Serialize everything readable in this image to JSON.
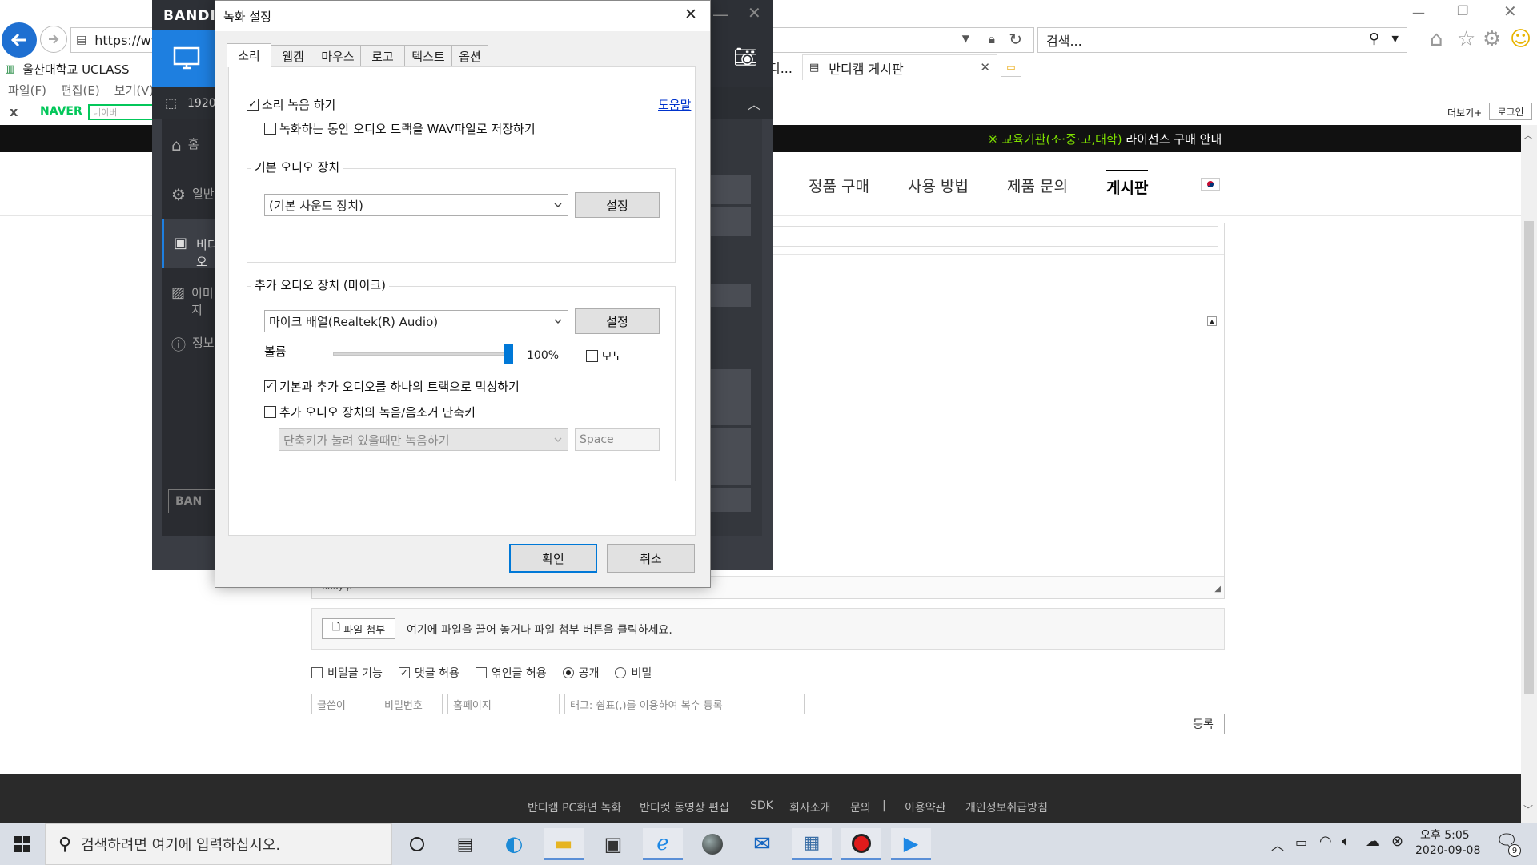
{
  "browser": {
    "url": "https://ww",
    "search_placeholder": "검색...",
    "tabs": [
      {
        "label": "디..."
      },
      {
        "label": "반디캠 게시판"
      }
    ],
    "favorites": {
      "uclass": "울산대학교 UCLASS"
    },
    "menu": [
      "파일(F)",
      "편집(E)",
      "보기(V)"
    ],
    "naver": {
      "logo": "NAVER",
      "search_placeholder": "네이버",
      "more": "더보기+",
      "login": "로그인",
      "close": "x"
    }
  },
  "site": {
    "notice_highlight": "※ 교육기관(조·중·고,대학)",
    "notice_rest": " 라이선스 구매 안내",
    "nav": [
      "정품 구매",
      "사용 방법",
      "제품 문의",
      "게시판"
    ],
    "editor_status": "body   p",
    "attach_button": "파일 첨부",
    "attach_hint": "여기에 파일을 끌어 놓거나 파일 첨부 버튼을 클릭하세요.",
    "options": [
      {
        "label": "비밀글 기능",
        "checked": false
      },
      {
        "label": "댓글 허용",
        "checked": true
      },
      {
        "label": "엮인글 허용",
        "checked": false
      }
    ],
    "visibility": [
      {
        "label": "공개",
        "selected": true
      },
      {
        "label": "비밀",
        "selected": false
      }
    ],
    "fields": {
      "author": "글쓴이",
      "password": "비밀번호",
      "homepage": "홈페이지",
      "tags": "태그: 쉼표(,)를 이용하여 복수 등록"
    },
    "submit": "등록",
    "footer_links": [
      "반디캠 PC화면 녹화",
      "반디컷 동영상 편집",
      "SDK",
      "회사소개",
      "문의",
      "|",
      "이용약관",
      "개인정보취급방침"
    ]
  },
  "bandicam": {
    "brand": "BANDI",
    "resolution": "1920",
    "side_items": [
      "홈",
      "일반",
      "비디오",
      "이미지",
      "정보"
    ],
    "bottom_brand": "BAN"
  },
  "dialog": {
    "title": "녹화 설정",
    "tabs": [
      "소리",
      "웹캠",
      "마우스",
      "로고",
      "텍스트",
      "옵션"
    ],
    "record_sound": "소리 녹음 하기",
    "help": "도움말",
    "save_wav": "녹화하는 동안 오디오 트랙을 WAV파일로 저장하기",
    "primary_group": "기본 오디오 장치",
    "primary_device": "(기본 사운드 장치)",
    "settings": "설정",
    "secondary_group": "추가 오디오 장치 (마이크)",
    "secondary_device": "마이크 배열(Realtek(R) Audio)",
    "volume_label": "볼륨",
    "volume_value": "100%",
    "volume_fraction": 1.0,
    "mono": "모노",
    "mix_tracks": "기본과 추가 오디오를 하나의 트랙으로 믹싱하기",
    "hotkey": "추가 오디오 장치의 녹음/음소거 단축키",
    "hotkey_mode": "단축키가 눌려 있을때만 녹음하기",
    "hotkey_key": "Space",
    "ok": "확인",
    "cancel": "취소"
  },
  "taskbar": {
    "search_placeholder": "검색하려면 여기에 입력하십시오.",
    "time": "오후 5:05",
    "date": "2020-09-08",
    "notifications": "9"
  },
  "colors": {
    "accent": "#0078d7",
    "naver_green": "#03c75a",
    "notice_green": "#7ee000"
  }
}
